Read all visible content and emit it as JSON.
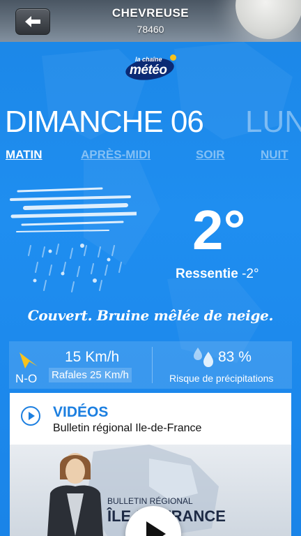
{
  "header": {
    "city": "CHEVREUSE",
    "zip": "78460",
    "back_icon": "arrow-left-icon"
  },
  "logo": {
    "small_text": "la chaîne",
    "big_text": "météo"
  },
  "day": {
    "current": "DIMANCHE 06",
    "next": "LUN"
  },
  "tabs": [
    {
      "label": "MATIN",
      "active": true
    },
    {
      "label": "APRÈS-MIDI",
      "active": false
    },
    {
      "label": "SOIR",
      "active": false
    },
    {
      "label": "NUIT",
      "active": false
    }
  ],
  "weather": {
    "icon": "cloud-sleet-icon",
    "temperature": "2°",
    "feels_label": "Ressentie",
    "feels_value": "-2°",
    "description": "Couvert. Bruine mêlée de neige."
  },
  "wind": {
    "icon": "wind-direction-icon",
    "direction": "N-O",
    "speed": "15 Km/h",
    "gusts": "Rafales 25 Km/h"
  },
  "precipitation": {
    "icon": "rain-drops-icon",
    "value": "83 %",
    "label": "Risque de précipitations"
  },
  "video": {
    "title": "VIDÉOS",
    "subtitle": "Bulletin régional Ile-de-France",
    "thumb_small": "BULLETIN RÉGIONAL",
    "thumb_big": "ÎLE-DE FRANCE"
  },
  "colors": {
    "background": "#1f8ef0",
    "accent": "#1c7fe0",
    "wind_icon": "#f7c21c"
  }
}
